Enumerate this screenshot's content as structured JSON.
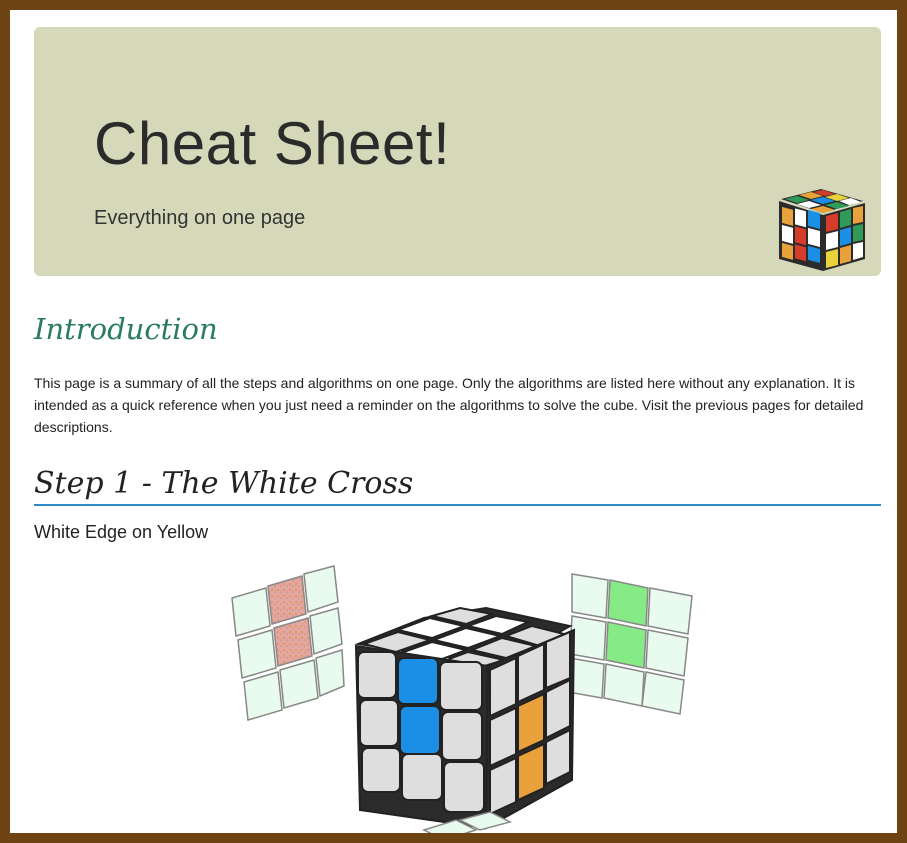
{
  "header": {
    "title": "Cheat Sheet!",
    "subtitle": "Everything on one page",
    "logo_icon": "rubiks-cube-icon"
  },
  "introduction": {
    "heading": "Introduction",
    "text": "This page is a summary of all the steps and algorithms on one page. Only the algorithms are listed here without any explanation. It is intended as a quick reference when you just need a reminder on the algorithms to solve the cube. Visit the previous pages for detailed descriptions."
  },
  "step1": {
    "heading": "Step 1 - The White Cross",
    "subheading": "White Edge on Yellow",
    "figure_icon": "cube-diagram-icon"
  },
  "colors": {
    "frame": "#6e4415",
    "hero_bg": "#d6d9b9",
    "intro_heading": "#2a7d5c",
    "rule": "#2e8bc8",
    "cube_blue": "#1b8fe6",
    "cube_orange": "#e9a23b",
    "cube_green": "#86ea86",
    "cube_pink": "#e2a79e"
  }
}
